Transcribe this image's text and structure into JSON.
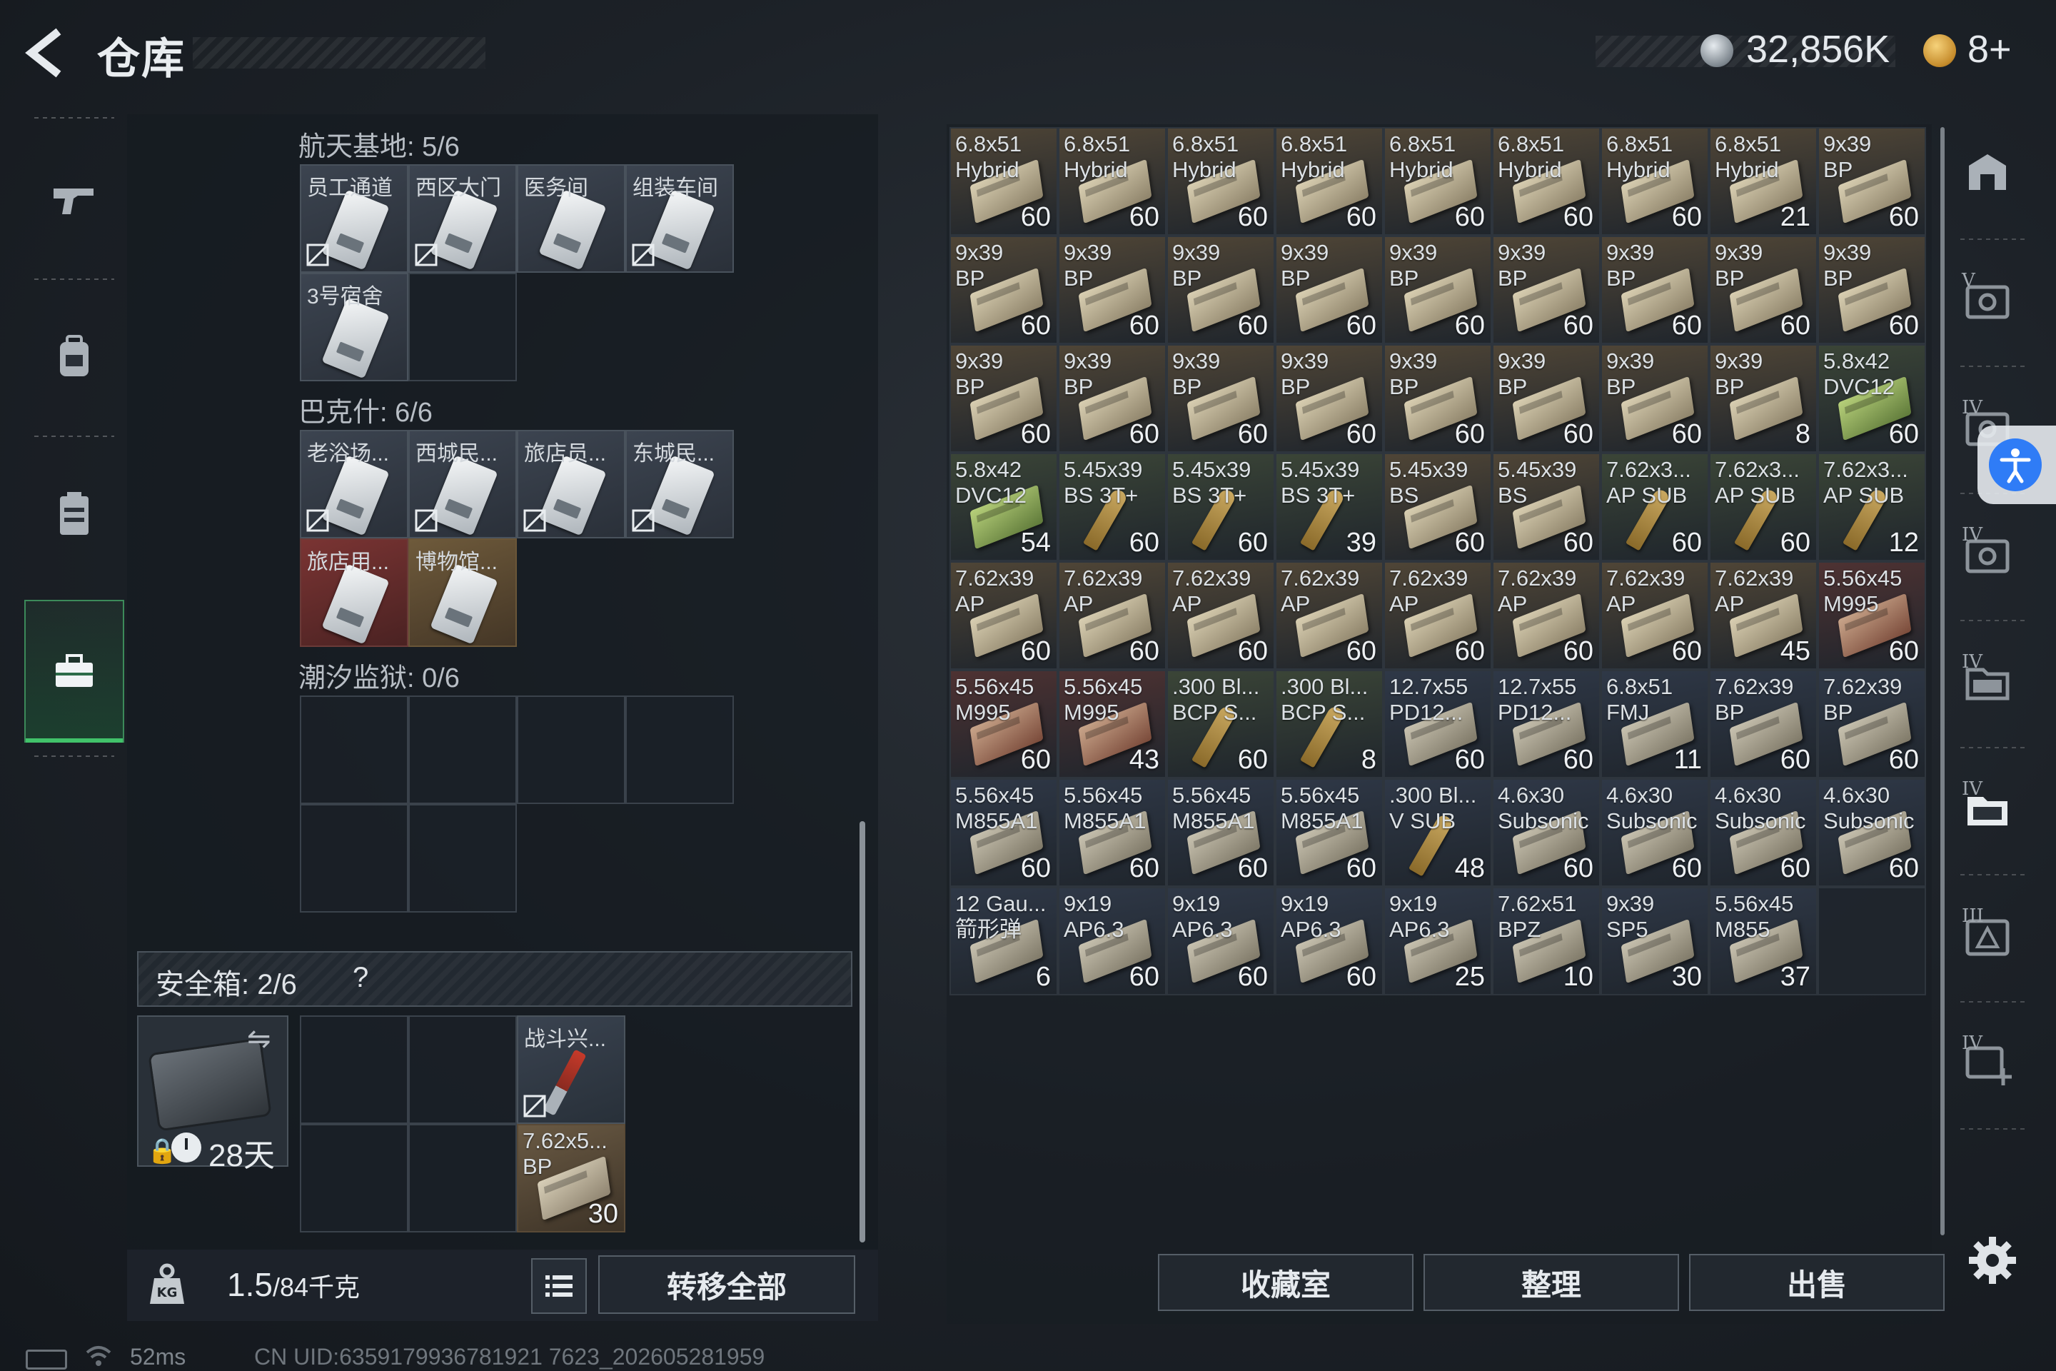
{
  "header": {
    "title": "仓库",
    "money": "32,856K",
    "tickets": "8+"
  },
  "left_nav": [
    {
      "icon": "gun-icon"
    },
    {
      "icon": "backpack-icon"
    },
    {
      "icon": "vest-icon"
    },
    {
      "icon": "toolbox-icon",
      "active": true
    }
  ],
  "key_groups": [
    {
      "label": "航天基地: 5/6",
      "keys": [
        {
          "name": "员工通道",
          "style": "gray",
          "broken": true
        },
        {
          "name": "西区大门",
          "style": "gray",
          "broken": true
        },
        {
          "name": "医务间",
          "style": "gray",
          "broken": false
        },
        {
          "name": "组装车间",
          "style": "gray",
          "broken": true
        },
        {
          "name": "3号宿舍",
          "style": "gray",
          "broken": false
        }
      ]
    },
    {
      "label": "巴克什: 6/6",
      "keys": [
        {
          "name": "老浴场...",
          "style": "gray",
          "broken": true
        },
        {
          "name": "西城民...",
          "style": "gray",
          "broken": true
        },
        {
          "name": "旅店员...",
          "style": "gray",
          "broken": true
        },
        {
          "name": "东城民...",
          "style": "gray",
          "broken": true
        },
        {
          "name": "旅店用...",
          "style": "red",
          "broken": false
        },
        {
          "name": "博物馆...",
          "style": "gold",
          "broken": false
        }
      ]
    },
    {
      "label": "潮汐监狱: 0/6",
      "keys": []
    }
  ],
  "safebox": {
    "label": "安全箱: 2/6",
    "help": "?",
    "days": "28天",
    "items": [
      {
        "name": "战斗兴...",
        "broken": true
      },
      {
        "name": "7.62x5...\nBP",
        "count": "30"
      }
    ]
  },
  "footer_left": {
    "weight": "1.5",
    "weight_max": "/84千克",
    "transfer_label": "转移全部"
  },
  "ammo": [
    {
      "name": "6.8x51\nHybrid",
      "count": "60",
      "color": "tan"
    },
    {
      "name": "6.8x51\nHybrid",
      "count": "60",
      "color": "tan"
    },
    {
      "name": "6.8x51\nHybrid",
      "count": "60",
      "color": "tan"
    },
    {
      "name": "6.8x51\nHybrid",
      "count": "60",
      "color": "tan"
    },
    {
      "name": "6.8x51\nHybrid",
      "count": "60",
      "color": "tan"
    },
    {
      "name": "6.8x51\nHybrid",
      "count": "60",
      "color": "tan"
    },
    {
      "name": "6.8x51\nHybrid",
      "count": "60",
      "color": "tan"
    },
    {
      "name": "6.8x51\nHybrid",
      "count": "21",
      "color": "tan"
    },
    {
      "name": "9x39\nBP",
      "count": "60",
      "color": "tan"
    },
    {
      "name": "9x39\nBP",
      "count": "60",
      "color": "tan"
    },
    {
      "name": "9x39\nBP",
      "count": "60",
      "color": "tan"
    },
    {
      "name": "9x39\nBP",
      "count": "60",
      "color": "tan"
    },
    {
      "name": "9x39\nBP",
      "count": "60",
      "color": "tan"
    },
    {
      "name": "9x39\nBP",
      "count": "60",
      "color": "tan"
    },
    {
      "name": "9x39\nBP",
      "count": "60",
      "color": "tan"
    },
    {
      "name": "9x39\nBP",
      "count": "60",
      "color": "tan"
    },
    {
      "name": "9x39\nBP",
      "count": "60",
      "color": "tan"
    },
    {
      "name": "9x39\nBP",
      "count": "60",
      "color": "tan"
    },
    {
      "name": "9x39\nBP",
      "count": "60",
      "color": "tan"
    },
    {
      "name": "9x39\nBP",
      "count": "60",
      "color": "tan"
    },
    {
      "name": "9x39\nBP",
      "count": "60",
      "color": "tan"
    },
    {
      "name": "9x39\nBP",
      "count": "60",
      "color": "tan"
    },
    {
      "name": "9x39\nBP",
      "count": "60",
      "color": "tan"
    },
    {
      "name": "9x39\nBP",
      "count": "60",
      "color": "tan"
    },
    {
      "name": "9x39\nBP",
      "count": "60",
      "color": "tan"
    },
    {
      "name": "9x39\nBP",
      "count": "8",
      "color": "tan"
    },
    {
      "name": "5.8x42\nDVC12",
      "count": "60",
      "color": "green"
    },
    {
      "name": "5.8x42\nDVC12",
      "count": "54",
      "color": "green"
    },
    {
      "name": "5.45x39\nBS 3T+",
      "count": "60",
      "color": "green"
    },
    {
      "name": "5.45x39\nBS 3T+",
      "count": "60",
      "color": "green"
    },
    {
      "name": "5.45x39\nBS 3T+",
      "count": "39",
      "color": "green"
    },
    {
      "name": "5.45x39\nBS",
      "count": "60",
      "color": "tan"
    },
    {
      "name": "5.45x39\nBS",
      "count": "60",
      "color": "tan"
    },
    {
      "name": "7.62x3...\nAP SUB",
      "count": "60",
      "color": "green"
    },
    {
      "name": "7.62x3...\nAP SUB",
      "count": "60",
      "color": "green"
    },
    {
      "name": "7.62x3...\nAP SUB",
      "count": "12",
      "color": "green"
    },
    {
      "name": "7.62x39\nAP",
      "count": "60",
      "color": "tan"
    },
    {
      "name": "7.62x39\nAP",
      "count": "60",
      "color": "tan"
    },
    {
      "name": "7.62x39\nAP",
      "count": "60",
      "color": "tan"
    },
    {
      "name": "7.62x39\nAP",
      "count": "60",
      "color": "tan"
    },
    {
      "name": "7.62x39\nAP",
      "count": "60",
      "color": "tan"
    },
    {
      "name": "7.62x39\nAP",
      "count": "60",
      "color": "tan"
    },
    {
      "name": "7.62x39\nAP",
      "count": "60",
      "color": "tan"
    },
    {
      "name": "7.62x39\nAP",
      "count": "45",
      "color": "tan"
    },
    {
      "name": "5.56x45\nM995",
      "count": "60",
      "color": "red"
    },
    {
      "name": "5.56x45\nM995",
      "count": "60",
      "color": "red"
    },
    {
      "name": "5.56x45\nM995",
      "count": "43",
      "color": "red"
    },
    {
      "name": ".300 Bl...\nBCP S...",
      "count": "60",
      "color": "green"
    },
    {
      "name": ".300 Bl...\nBCP S...",
      "count": "8",
      "color": "green"
    },
    {
      "name": "12.7x55\nPD12...",
      "count": "60",
      "color": "blue"
    },
    {
      "name": "12.7x55\nPD12...",
      "count": "60",
      "color": "blue"
    },
    {
      "name": "6.8x51\nFMJ",
      "count": "11",
      "color": "blue"
    },
    {
      "name": "7.62x39\nBP",
      "count": "60",
      "color": "blue"
    },
    {
      "name": "7.62x39\nBP",
      "count": "60",
      "color": "blue"
    },
    {
      "name": "5.56x45\nM855A1",
      "count": "60",
      "color": "blue"
    },
    {
      "name": "5.56x45\nM855A1",
      "count": "60",
      "color": "blue"
    },
    {
      "name": "5.56x45\nM855A1",
      "count": "60",
      "color": "blue"
    },
    {
      "name": "5.56x45\nM855A1",
      "count": "60",
      "color": "blue"
    },
    {
      "name": ".300 Bl...\nV SUB",
      "count": "48",
      "color": "blue"
    },
    {
      "name": "4.6x30\nSubsonic",
      "count": "60",
      "color": "blue"
    },
    {
      "name": "4.6x30\nSubsonic",
      "count": "60",
      "color": "blue"
    },
    {
      "name": "4.6x30\nSubsonic",
      "count": "60",
      "color": "blue"
    },
    {
      "name": "4.6x30\nSubsonic",
      "count": "60",
      "color": "blue"
    },
    {
      "name": "12 Gau...\n箭形弹",
      "count": "6",
      "color": "blue"
    },
    {
      "name": "9x19\nAP6.3",
      "count": "60",
      "color": "blue"
    },
    {
      "name": "9x19\nAP6.3",
      "count": "60",
      "color": "blue"
    },
    {
      "name": "9x19\nAP6.3",
      "count": "60",
      "color": "blue"
    },
    {
      "name": "9x19\nAP6.3",
      "count": "25",
      "color": "blue"
    },
    {
      "name": "7.62x51\nBPZ",
      "count": "10",
      "color": "blue"
    },
    {
      "name": "9x39\nSP5",
      "count": "30",
      "color": "blue"
    },
    {
      "name": "5.56x45\nM855",
      "count": "37",
      "color": "blue"
    }
  ],
  "actions": {
    "collection": "收藏室",
    "sort": "整理",
    "sell": "出售"
  },
  "right_nav": [
    {
      "icon": "hideout-icon",
      "tier": ""
    },
    {
      "icon": "vault-icon",
      "tier": "V"
    },
    {
      "icon": "vault-icon",
      "tier": "IV"
    },
    {
      "icon": "vault-icon",
      "tier": "IV"
    },
    {
      "icon": "folder-icon",
      "tier": "IV"
    },
    {
      "icon": "folder-active-icon",
      "tier": "IV"
    },
    {
      "icon": "triangle-box-icon",
      "tier": "III"
    },
    {
      "icon": "add-box-icon",
      "tier": "IV"
    }
  ],
  "colors": {
    "accent_green": "#41c26a",
    "cell_tan": "#5a4b38",
    "cell_green": "#3f4a3a",
    "cell_red": "#5a3232",
    "cell_blue": "#323c4c",
    "accessibility_blue": "#2f7cf6"
  },
  "status": {
    "ping": "52ms",
    "uid": "CN UID:6359179936781921 7623_202605281959"
  }
}
